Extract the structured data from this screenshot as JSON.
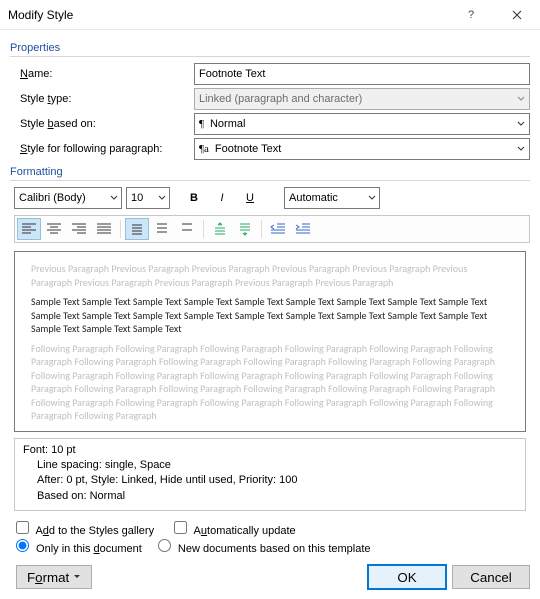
{
  "window": {
    "title": "Modify Style"
  },
  "groups": {
    "properties": "Properties",
    "formatting": "Formatting"
  },
  "labels": {
    "name": "Name:",
    "style_type": "Style type:",
    "based_on": "Style based on:",
    "following": "Style for following paragraph:"
  },
  "values": {
    "name": "Footnote Text",
    "style_type": "Linked (paragraph and character)",
    "based_on": "Normal",
    "following": "Footnote Text"
  },
  "format": {
    "font_name": "Calibri (Body)",
    "font_size": "10",
    "color": "Automatic",
    "bold": "B",
    "italic": "I",
    "underline": "U"
  },
  "preview": {
    "prev": "Previous Paragraph Previous Paragraph Previous Paragraph Previous Paragraph Previous Paragraph Previous Paragraph Previous Paragraph Previous Paragraph Previous Paragraph Previous Paragraph",
    "sample": "Sample Text Sample Text Sample Text Sample Text Sample Text Sample Text Sample Text Sample Text Sample Text Sample Text Sample Text Sample Text Sample Text Sample Text Sample Text Sample Text Sample Text Sample Text Sample Text Sample Text Sample Text",
    "next": "Following Paragraph Following Paragraph Following Paragraph Following Paragraph Following Paragraph Following Paragraph Following Paragraph Following Paragraph Following Paragraph Following Paragraph Following Paragraph Following Paragraph Following Paragraph Following Paragraph Following Paragraph Following Paragraph Following Paragraph Following Paragraph Following Paragraph Following Paragraph Following Paragraph Following Paragraph Following Paragraph Following Paragraph Following Paragraph Following Paragraph Following Paragraph Following Paragraph Following Paragraph"
  },
  "description": {
    "line1": "Font: 10 pt",
    "line2": "Line spacing:  single, Space",
    "line3": "After:  0 pt, Style: Linked, Hide until used, Priority: 100",
    "line4": "Based on: Normal"
  },
  "options": {
    "add_gallery": "Add to the Styles gallery",
    "auto_update": "Automatically update",
    "only_doc": "Only in this document",
    "new_docs": "New documents based on this template"
  },
  "buttons": {
    "format": "Format",
    "ok": "OK",
    "cancel": "Cancel"
  },
  "accent_color": "#1e4e9c"
}
